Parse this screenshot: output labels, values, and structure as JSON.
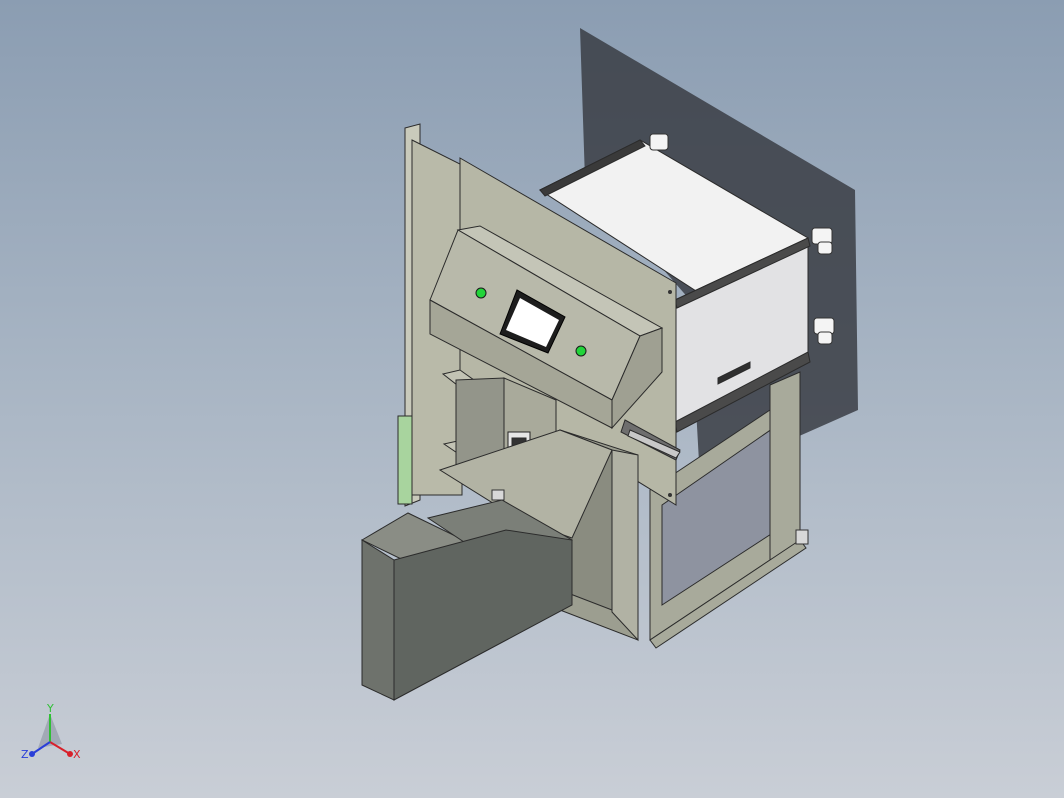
{
  "viewport": {
    "background_top": "#8b9db2",
    "background_bottom": "#c9ced6"
  },
  "model": {
    "frame_color": "#a9ab9c",
    "panel_color": "#b4b5a5",
    "cabinet_color": "#ececec",
    "indicator_color": "#22d43a",
    "screen_color": "#ffffff"
  },
  "triad": {
    "x_label": "X",
    "y_label": "Y",
    "z_label": "Z",
    "x_color": "#d8202a",
    "y_color": "#2fbf35",
    "z_color": "#2a3fd8"
  }
}
